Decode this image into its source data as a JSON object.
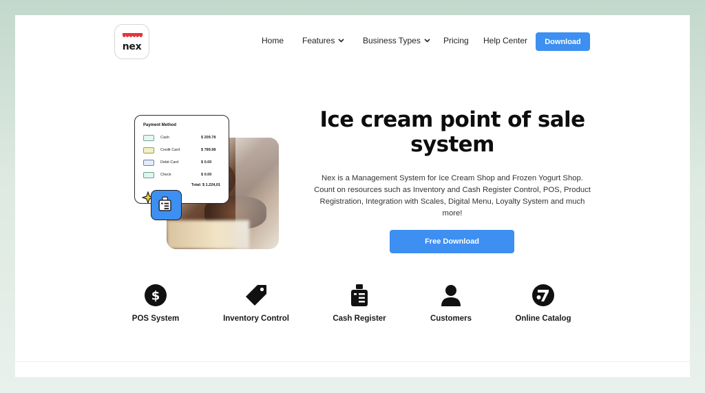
{
  "header": {
    "logo_text": "nex",
    "nav": [
      {
        "label": "Home"
      },
      {
        "label": "Features",
        "dropdown": true
      },
      {
        "label": "Business Types",
        "dropdown": true
      },
      {
        "label": "Pricing"
      },
      {
        "label": "Help Center"
      }
    ],
    "download_label": "Download"
  },
  "hero": {
    "title": "Ice cream point of sale system",
    "description": "Nex is a Management System for Ice Cream Shop and Frozen Yogurt Shop. Count on resources such as Inventory and Cash Register Control, POS, Product Registration, Integration with Scales, Digital Menu, Loyalty System and much more!",
    "cta_label": "Free Download",
    "payment_card": {
      "title": "Payment Method",
      "rows": [
        {
          "label": "Cash",
          "value": "$ 209.78"
        },
        {
          "label": "Credit Card",
          "value": "$ 789.98"
        },
        {
          "label": "Debit Card",
          "value": "$ 0.00"
        },
        {
          "label": "Check",
          "value": "$ 0.00"
        }
      ],
      "total": "Total: $ 1.224,01"
    }
  },
  "features": [
    {
      "label": "POS System",
      "icon": "dollar-icon"
    },
    {
      "label": "Inventory Control",
      "icon": "tag-icon"
    },
    {
      "label": "Cash Register",
      "icon": "cash-register-icon"
    },
    {
      "label": "Customers",
      "icon": "user-icon"
    },
    {
      "label": "Online Catalog",
      "icon": "catalog-icon"
    }
  ],
  "colors": {
    "accent": "#3d8ff1",
    "logo_red": "#e8343a",
    "background": "#c3d8cc"
  }
}
